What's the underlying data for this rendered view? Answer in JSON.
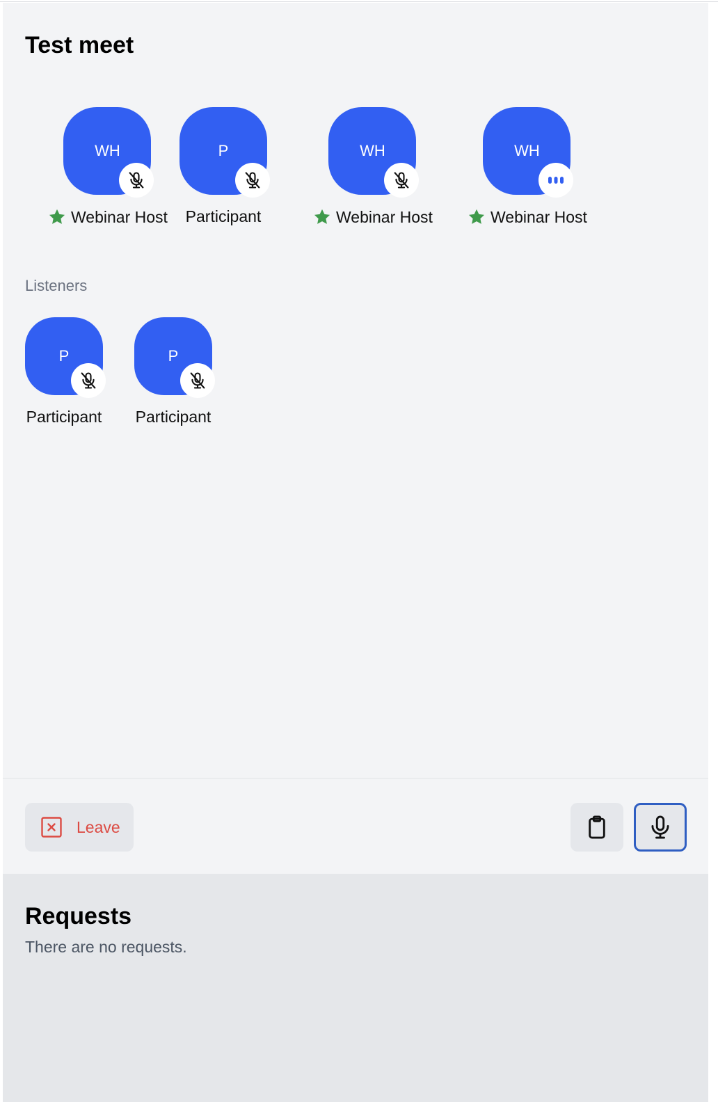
{
  "meeting": {
    "title": "Test meet"
  },
  "speakers": [
    {
      "initials": "WH",
      "name": "Webinar Host",
      "host": true,
      "status": "muted"
    },
    {
      "initials": "P",
      "name": "Participant",
      "host": false,
      "status": "muted"
    },
    {
      "initials": "WH",
      "name": "Webinar Host",
      "host": true,
      "status": "muted"
    },
    {
      "initials": "WH",
      "name": "Webinar Host",
      "host": true,
      "status": "speaking"
    }
  ],
  "listeners": {
    "label": "Listeners",
    "items": [
      {
        "initials": "P",
        "name": "Participant",
        "status": "muted"
      },
      {
        "initials": "P",
        "name": "Participant",
        "status": "muted"
      }
    ]
  },
  "controls": {
    "leave_label": "Leave",
    "icons": [
      "close-square-icon",
      "clipboard-icon",
      "microphone-icon"
    ]
  },
  "requests": {
    "title": "Requests",
    "empty_text": "There are no requests."
  },
  "colors": {
    "avatar": "#325ff2",
    "host_star": "#3f9a4b",
    "leave": "#dc4b43",
    "mic_outline": "#2f5ec2"
  }
}
